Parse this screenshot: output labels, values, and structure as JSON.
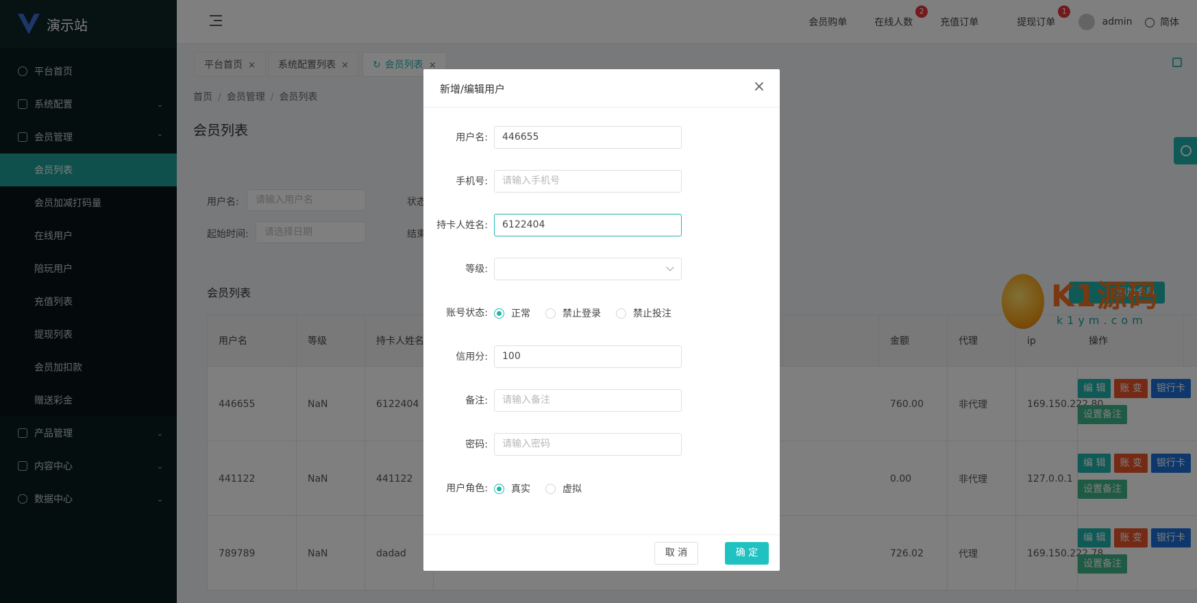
{
  "app": {
    "title": "演示站"
  },
  "sidebar": {
    "items": [
      {
        "label": "平台首页",
        "icon": "dashboard-icon"
      },
      {
        "label": "系统配置",
        "icon": "edit-icon"
      },
      {
        "label": "会员管理",
        "icon": "table-icon"
      },
      {
        "label": "产品管理",
        "icon": "grid-icon"
      },
      {
        "label": "内容中心",
        "icon": "document-icon"
      },
      {
        "label": "数据中心",
        "icon": "check-circle-icon"
      }
    ],
    "submenu": [
      "会员列表",
      "会员加减打码量",
      "在线用户",
      "陪玩用户",
      "充值列表",
      "提现列表",
      "会员加扣款",
      "赠送彩金"
    ]
  },
  "header": {
    "member_buy": "会员购单",
    "online_count": "在线人数",
    "online_badge": "2",
    "recharge_orders": "充值订单",
    "withdraw_orders": "提现订单",
    "withdraw_badge": "1",
    "username": "admin",
    "language": "简体"
  },
  "tabs": [
    {
      "label": "平台首页",
      "close": "×"
    },
    {
      "label": "系统配置列表",
      "close": "×"
    },
    {
      "label": "会员列表",
      "close": "×"
    }
  ],
  "breadcrumb": [
    "首页",
    "会员管理",
    "会员列表"
  ],
  "breadcrumb_sep": "/",
  "page_title": "会员列表",
  "filters": {
    "username_label": "用户名:",
    "username_placeholder": "请输入用户名",
    "status_label": "状态",
    "start_label": "起始时间:",
    "start_placeholder": "请选择日期",
    "end_label": "结束"
  },
  "section_title": "会员列表",
  "add_button": "添加会员",
  "table": {
    "headers": [
      "用户名",
      "等级",
      "持卡人姓名",
      "",
      "",
      "",
      "",
      "",
      "金额",
      "代理",
      "ip",
      "操作"
    ],
    "rows": [
      {
        "username": "446655",
        "level": "NaN",
        "holder": "6122404",
        "amount": "760.00",
        "agent": "非代理",
        "ip": "169.150.222.80"
      },
      {
        "username": "441122",
        "level": "NaN",
        "holder": "441122",
        "amount": "0.00",
        "agent": "非代理",
        "ip": "127.0.0.1"
      },
      {
        "username": "789789",
        "level": "NaN",
        "holder": "dadad",
        "amount": "726.02",
        "agent": "代理",
        "ip": "169.150.222.78"
      }
    ],
    "ops": {
      "edit": "编 辑",
      "account": "账 变",
      "bank": "银行卡",
      "note": "设置备注"
    }
  },
  "modal": {
    "title": "新增/编辑用户",
    "close": "×",
    "fields": {
      "username_label": "用户名:",
      "username_value": "446655",
      "phone_label": "手机号:",
      "phone_placeholder": "请输入手机号",
      "holder_label": "持卡人姓名:",
      "holder_value": "6122404",
      "level_label": "等级:",
      "status_label": "账号状态:",
      "status_options": [
        "正常",
        "禁止登录",
        "禁止投注"
      ],
      "status_selected": "正常",
      "credit_label": "信用分:",
      "credit_value": "100",
      "note_label": "备注:",
      "note_placeholder": "请输入备注",
      "password_label": "密码:",
      "password_placeholder": "请输入密码",
      "role_label": "用户角色:",
      "role_options": [
        "真实",
        "虚拟"
      ],
      "role_selected": "真实"
    },
    "cancel": "取 消",
    "ok": "确 定"
  },
  "watermark": {
    "text": "K1源码",
    "sub": "k1ym.com"
  },
  "colors": {
    "accent": "#1fb5ad",
    "sidebar_bg": "#0b1c1f",
    "danger": "#e8542a",
    "primary": "#1c70d6"
  }
}
